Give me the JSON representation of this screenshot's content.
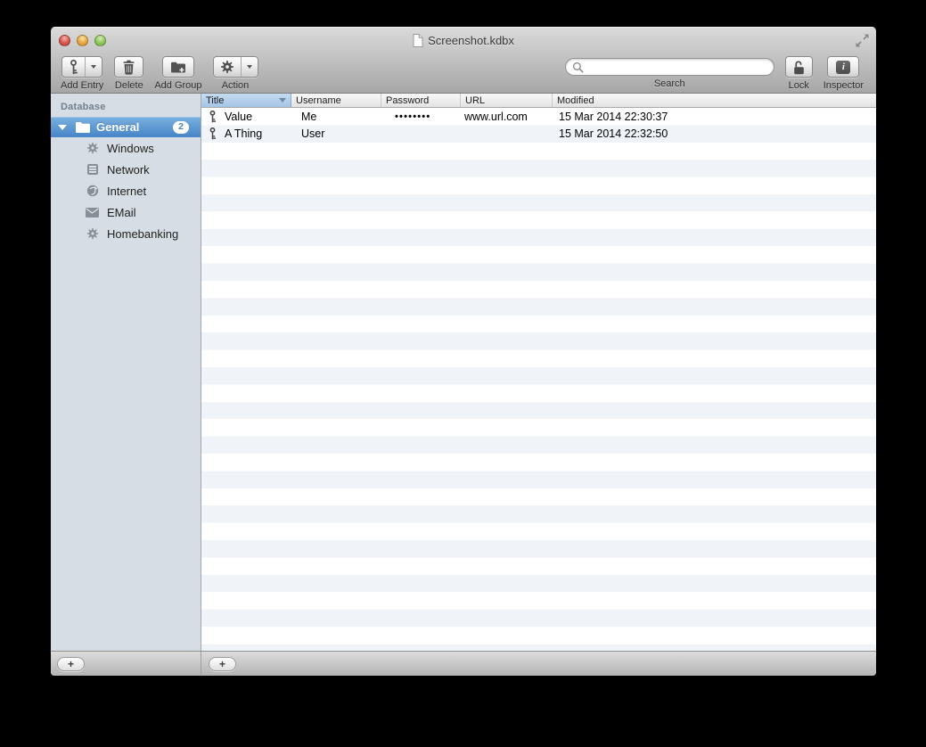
{
  "window": {
    "title": "Screenshot.kdbx"
  },
  "toolbar": {
    "add_entry": {
      "label": "Add Entry",
      "icon": "key-icon",
      "has_dropdown": true
    },
    "delete": {
      "label": "Delete",
      "icon": "trash-icon"
    },
    "add_group": {
      "label": "Add Group",
      "icon": "folder-plus-icon"
    },
    "action": {
      "label": "Action",
      "icon": "gear-icon",
      "has_dropdown": true
    },
    "search": {
      "label": "Search",
      "value": "",
      "icon": "magnifier-icon"
    },
    "lock": {
      "label": "Lock",
      "icon": "padlock-open-icon"
    },
    "inspector": {
      "label": "Inspector",
      "icon": "info-icon"
    }
  },
  "sidebar": {
    "section_label": "Database",
    "groups": [
      {
        "label": "General",
        "badge": "2",
        "selected": true,
        "expanded": true,
        "icon": "folder-icon"
      },
      {
        "label": "Windows",
        "icon": "gear-icon"
      },
      {
        "label": "Network",
        "icon": "server-icon"
      },
      {
        "label": "Internet",
        "icon": "globe-icon"
      },
      {
        "label": "EMail",
        "icon": "envelope-icon"
      },
      {
        "label": "Homebanking",
        "icon": "gear-icon"
      }
    ],
    "add_button_label": "+"
  },
  "table": {
    "columns": [
      "Title",
      "Username",
      "Password",
      "URL",
      "Modified"
    ],
    "sort": {
      "column": "Title",
      "direction": "desc"
    },
    "rows": [
      {
        "icon": "key-icon",
        "title": "Value",
        "username": "Me",
        "password": "••••••••",
        "url": "www.url.com",
        "modified": "15 Mar 2014 22:30:37"
      },
      {
        "icon": "key-icon",
        "title": "A Thing",
        "username": "User",
        "password": "",
        "url": "",
        "modified": "15 Mar 2014 22:32:50"
      }
    ],
    "add_button_label": "+"
  },
  "colors": {
    "selection_blue_top": "#7ab1e0",
    "selection_blue_bottom": "#4584c7",
    "sorted_header_top": "#c6dcf1",
    "sorted_header_bottom": "#a4c4e6",
    "row_stripe": "#f0f4f9",
    "sidebar_bg": "#d6dde4",
    "badge_text": "#5781ad"
  }
}
